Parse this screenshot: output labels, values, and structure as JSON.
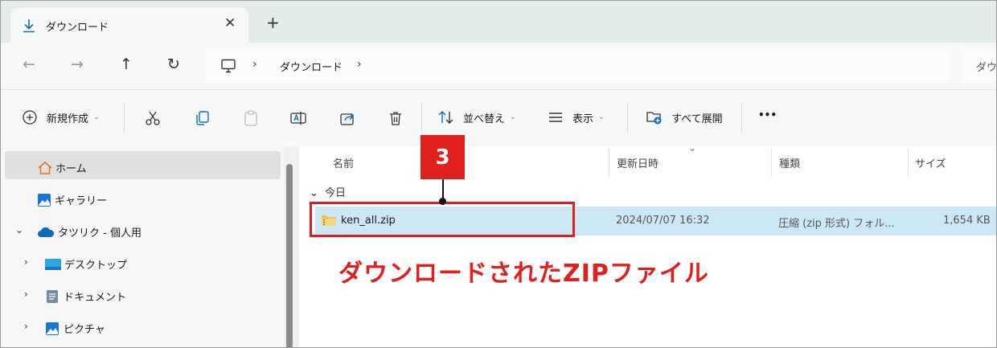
{
  "tab": {
    "title": "ダウンロード",
    "close": "✕",
    "new_tab": "+"
  },
  "nav": {
    "back": "←",
    "forward": "→",
    "up": "↑",
    "refresh": "↻"
  },
  "address": {
    "sep1": "›",
    "crumb": "ダウンロード",
    "sep2": "›"
  },
  "search": {
    "text": "ダウ"
  },
  "toolbar": {
    "new": "新規作成",
    "sort": "並べ替え",
    "view": "表示",
    "expand_all": "すべて展開",
    "more": "•••",
    "chevron": "⌄"
  },
  "sidebar": {
    "home": "ホーム",
    "gallery": "ギャラリー",
    "onedrive": "タツリク - 個人用",
    "desktop": "デスクトップ",
    "documents": "ドキュメント",
    "pictures": "ピクチャ",
    "expander_open": "⌄",
    "expander_closed": "›"
  },
  "columns": {
    "name": "名前",
    "modified": "更新日時",
    "type": "種類",
    "size": "サイズ",
    "sort_caret": "⌄"
  },
  "group": {
    "label": "今日",
    "toggle": "⌄"
  },
  "files": [
    {
      "name": "ken_all.zip",
      "modified": "2024/07/07 16:32",
      "type": "圧縮 (zip 形式) フォル...",
      "size": "1,654 KB"
    }
  ],
  "annotation": {
    "step": "3",
    "caption": "ダウンロードされたZIPファイル",
    "color": "#e0201c"
  },
  "colors": {
    "selection": "#cce8f7",
    "accent": "#0f6cbd",
    "tab_strip": "#e3ece6"
  }
}
